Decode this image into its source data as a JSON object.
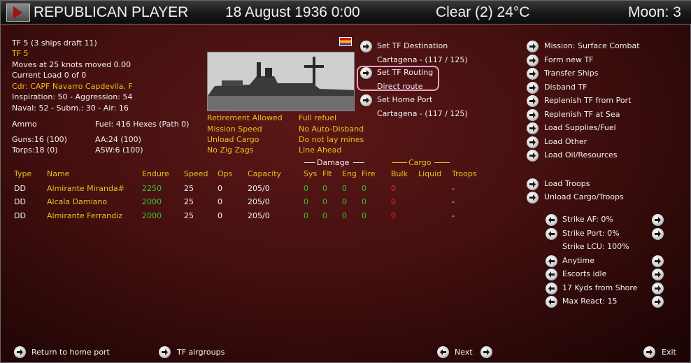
{
  "header": {
    "side": "REPUBLICAN PLAYER",
    "date": "18 August 1936 0:00",
    "weather": "Clear (2) 24°C",
    "moon": "Moon: 3"
  },
  "tf_info": {
    "line1": "TF 5 (3 ships draft 11)",
    "line2": "TF 5",
    "line3": "Moves at 25 knots moved 0.00",
    "line4": "Current Load 0 of 0",
    "line5": "Cdr: CAPF Navarro Capdevila, F",
    "line6": "Inspiration: 50 - Aggression: 54",
    "line7": "Naval: 52 - Subm.: 30 - Air: 16",
    "ammo": "Ammo",
    "fuel": "Fuel: 416 Hexes (Path 0)",
    "guns": "Guns:16 (100)",
    "aa": "AA:24 (100)",
    "torps": "Torps:18 (0)",
    "asw": "ASW:6 (100)"
  },
  "options": {
    "col1": [
      "Retirement Allowed",
      "Mission Speed",
      "Unload Cargo",
      "No Zig Zags"
    ],
    "col2": [
      "Full refuel",
      "No Auto-Disband",
      "Do not lay mines",
      "Line Ahead"
    ]
  },
  "middle_actions": {
    "set_destination": "Set TF Destination",
    "destination_value": "Cartagena - (117 / 125)",
    "set_routing": "Set TF Routing",
    "routing_value": "Direct route",
    "set_home_port": "Set Home Port",
    "home_port_value": "Cartagena - (117 / 125)"
  },
  "right_actions": [
    "Mission: Surface Combat",
    "Form new TF",
    "Transfer Ships",
    "Disband TF",
    "Replenish TF from Port",
    "Replenish TF at Sea",
    "Load Supplies/Fuel",
    "Load Other",
    "Load Oil/Resources"
  ],
  "troop_actions": [
    "Load Troops",
    "Unload Cargo/Troops"
  ],
  "strike_settings": {
    "strike_af": "Strike AF: 0%",
    "strike_port": "Strike Port: 0%",
    "strike_lcu": "Strike LCU: 100%",
    "anytime": "Anytime",
    "escorts": "Escorts idle",
    "range": "17 Kyds from Shore",
    "max_react": "Max React: 15"
  },
  "table": {
    "group_damage": "Damage",
    "group_cargo": "Cargo",
    "headers": [
      "Type",
      "Name",
      "Endure",
      "Speed",
      "Ops",
      "Capacity",
      "Sys",
      "Flt",
      "Eng",
      "Fire",
      "Bulk",
      "Liquid",
      "Troops"
    ],
    "rows": [
      {
        "type": "DD",
        "name": "Almirante Miranda#",
        "endure": "2250",
        "speed": "25",
        "ops": "0",
        "capacity": "205/0",
        "sys": "0",
        "flt": "0",
        "eng": "0",
        "fire": "0",
        "bulk": "0",
        "troops": "-"
      },
      {
        "type": "DD",
        "name": "Alcala Damiano",
        "endure": "2000",
        "speed": "25",
        "ops": "0",
        "capacity": "205/0",
        "sys": "0",
        "flt": "0",
        "eng": "0",
        "fire": "0",
        "bulk": "0",
        "troops": "-"
      },
      {
        "type": "DD",
        "name": "Almirante Ferrandiz",
        "endure": "2000",
        "speed": "25",
        "ops": "0",
        "capacity": "205/0",
        "sys": "0",
        "flt": "0",
        "eng": "0",
        "fire": "0",
        "bulk": "0",
        "troops": "-"
      }
    ]
  },
  "footer": {
    "return": "Return to home port",
    "airgroups": "TF airgroups",
    "next": "Next",
    "exit": "Exit"
  },
  "colors": {
    "highlight": "#e8c21a",
    "good": "#2ecc2e",
    "bad": "#e82a2a",
    "annotation": "#f2a0c8"
  },
  "icons": {
    "arrow": "arrow-right-icon",
    "arrow_left": "arrow-left-icon",
    "menu": "menu-triangle-icon",
    "flag": "flag-icon"
  }
}
